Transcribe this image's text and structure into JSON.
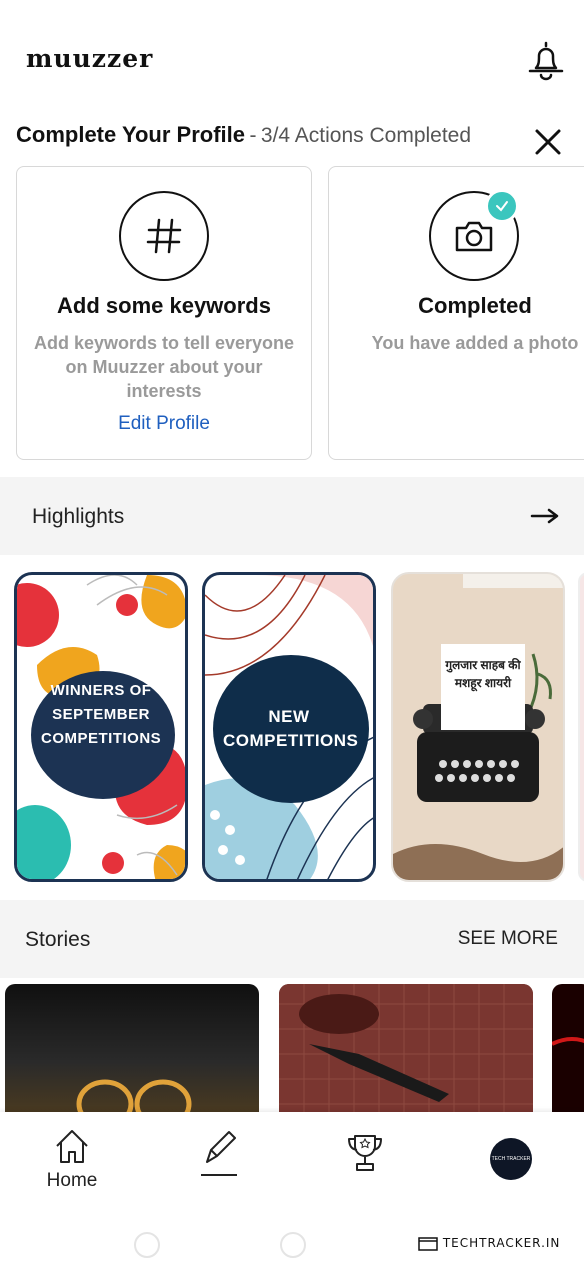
{
  "app": {
    "logo_text": "muuzzer"
  },
  "profile": {
    "title": "Complete Your Profile",
    "separator": "-",
    "progress_text": "3/4 Actions Completed",
    "cards": [
      {
        "icon": "hashtag-icon",
        "title": "Add some keywords",
        "description": "Add keywords to tell everyone on Muuzzer about your interests",
        "link": "Edit Profile",
        "completed": false
      },
      {
        "icon": "camera-icon",
        "title": "Completed",
        "description": "You have added a photo",
        "completed": true
      }
    ]
  },
  "highlights": {
    "title": "Highlights",
    "items": [
      {
        "text": "Winners of September Competitions"
      },
      {
        "text": "New Competitions"
      },
      {
        "text": "गुलजार साहब की मशहूर शायरी"
      }
    ]
  },
  "stories": {
    "title": "Stories",
    "see_more": "SEE MORE"
  },
  "nav": {
    "home_label": "Home",
    "avatar_text": "TECH TRACKER"
  },
  "watermark": "TECHTRACKER.IN",
  "colors": {
    "accent_link": "#1f5fbf",
    "check": "#3bc6be",
    "navy": "#1c3353"
  }
}
